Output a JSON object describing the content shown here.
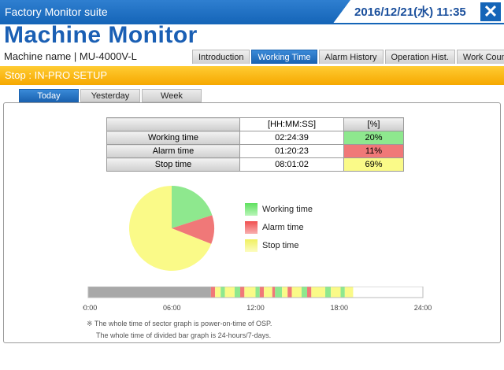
{
  "app": {
    "suite_title": "Factory Monitor suite",
    "datetime": "2016/12/21(水)  11:35",
    "title": "Machine Monitor",
    "machine_label": "Machine name  |  MU-4000V-L"
  },
  "nav_tabs": [
    "Introduction",
    "Working Time",
    "Alarm History",
    "Operation Hist.",
    "Work Counter"
  ],
  "active_nav_tab": "Working Time",
  "status": "Stop : IN-PRO SETUP",
  "period_tabs": [
    "Today",
    "Yesterday",
    "Week"
  ],
  "active_period_tab": "Today",
  "table": {
    "headers": [
      "[HH:MM:SS]",
      "[%]"
    ],
    "rows": [
      {
        "label": "Working time",
        "time": "02:24:39",
        "percent": "20%"
      },
      {
        "label": "Alarm time",
        "time": "01:20:23",
        "percent": "11%"
      },
      {
        "label": "Stop time",
        "time": "08:01:02",
        "percent": "69%"
      }
    ]
  },
  "chart_data": {
    "type": "pie",
    "categories": [
      "Working time",
      "Alarm time",
      "Stop time"
    ],
    "values": [
      20,
      11,
      69
    ],
    "colors": [
      "#8ee88e",
      "#f07878",
      "#fafa88"
    ]
  },
  "legend": [
    "Working time",
    "Alarm time",
    "Stop time"
  ],
  "timeline": {
    "ticks": [
      "00:00",
      "06:00",
      "12:00",
      "18:00",
      "24:00"
    ],
    "range_hours": [
      0,
      24
    ],
    "segments": [
      {
        "start": 0,
        "end": 8.8,
        "state": "off"
      },
      {
        "start": 8.8,
        "end": 9.1,
        "state": "alarm"
      },
      {
        "start": 9.1,
        "end": 9.5,
        "state": "stop"
      },
      {
        "start": 9.5,
        "end": 9.8,
        "state": "working"
      },
      {
        "start": 9.8,
        "end": 10.5,
        "state": "stop"
      },
      {
        "start": 10.5,
        "end": 10.9,
        "state": "working"
      },
      {
        "start": 10.9,
        "end": 11.2,
        "state": "alarm"
      },
      {
        "start": 11.2,
        "end": 12.0,
        "state": "stop"
      },
      {
        "start": 12.0,
        "end": 12.3,
        "state": "working"
      },
      {
        "start": 12.3,
        "end": 12.6,
        "state": "alarm"
      },
      {
        "start": 12.6,
        "end": 13.2,
        "state": "stop"
      },
      {
        "start": 13.2,
        "end": 13.4,
        "state": "alarm"
      },
      {
        "start": 13.4,
        "end": 13.9,
        "state": "working"
      },
      {
        "start": 13.9,
        "end": 14.3,
        "state": "stop"
      },
      {
        "start": 14.3,
        "end": 14.6,
        "state": "alarm"
      },
      {
        "start": 14.6,
        "end": 15.3,
        "state": "stop"
      },
      {
        "start": 15.3,
        "end": 15.7,
        "state": "working"
      },
      {
        "start": 15.7,
        "end": 16.0,
        "state": "alarm"
      },
      {
        "start": 16.0,
        "end": 17.0,
        "state": "stop"
      },
      {
        "start": 17.0,
        "end": 17.4,
        "state": "working"
      },
      {
        "start": 17.4,
        "end": 18.1,
        "state": "stop"
      },
      {
        "start": 18.1,
        "end": 18.4,
        "state": "working"
      },
      {
        "start": 18.4,
        "end": 19.0,
        "state": "stop"
      },
      {
        "start": 19.0,
        "end": 24.0,
        "state": "future"
      }
    ],
    "state_colors": {
      "off": "#a8a8a8",
      "working": "#8ee88e",
      "alarm": "#f07878",
      "stop": "#fafa88",
      "future": "#ffffff"
    }
  },
  "notes": [
    "※ The whole time of sector graph is power-on-time of OSP.",
    "The whole time of divided bar graph is 24-hours/7-days."
  ]
}
